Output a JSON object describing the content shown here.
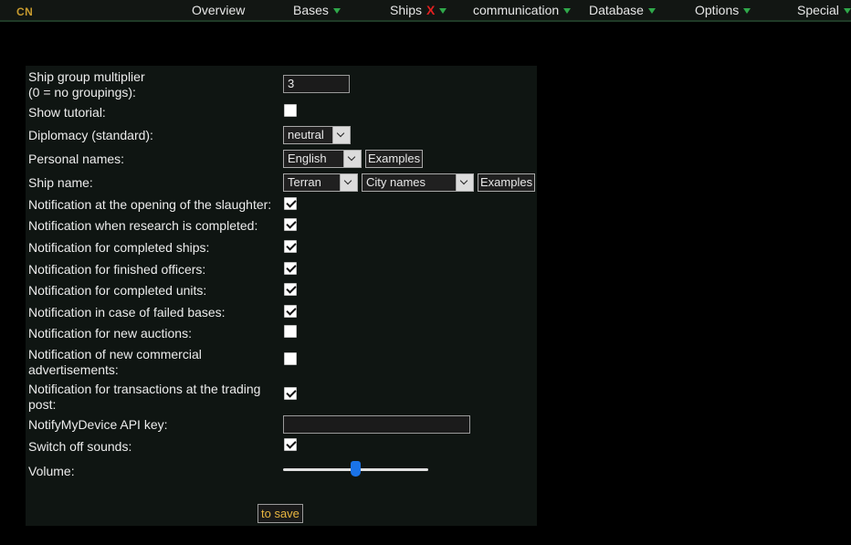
{
  "topbar": {
    "logo": "CN",
    "items": [
      {
        "label": "Overview"
      },
      {
        "label": "Bases"
      },
      {
        "label": "Ships"
      },
      {
        "label": "communication"
      },
      {
        "label": "Database"
      },
      {
        "label": "Options"
      },
      {
        "label": "Special"
      }
    ]
  },
  "settings": {
    "group_multiplier": {
      "label_line1": "Ship group multiplier",
      "label_line2": "(0 = no groupings):",
      "value": "3"
    },
    "tutorial": {
      "label": "Show tutorial:",
      "checked": false
    },
    "diplomacy": {
      "label": "Diplomacy (standard):",
      "value": "neutral"
    },
    "personal_names": {
      "label": "Personal names:",
      "value": "English",
      "examples": "Examples"
    },
    "ship_name": {
      "label": "Ship name:",
      "value1": "Terran",
      "value2": "City names",
      "examples": "Examples"
    },
    "notify_slaughter": {
      "label": "Notification at the opening of the slaughter:",
      "checked": true
    },
    "notify_research": {
      "label": "Notification when research is completed:",
      "checked": true
    },
    "notify_ships": {
      "label": "Notification for completed ships:",
      "checked": true
    },
    "notify_officers": {
      "label": "Notification for finished officers:",
      "checked": true
    },
    "notify_units": {
      "label": "Notification for completed units:",
      "checked": true
    },
    "notify_failed_bases": {
      "label": "Notification in case of failed bases:",
      "checked": true
    },
    "notify_auctions": {
      "label": "Notification for new auctions:",
      "checked": false
    },
    "notify_ads": {
      "label_line1": "Notification of new commercial",
      "label_line2": "advertisements:",
      "checked": false
    },
    "notify_trading": {
      "label_line1": "Notification for transactions at the trading",
      "label_line2": "post:",
      "checked": true
    },
    "api_key": {
      "label": "NotifyMyDevice API key:",
      "value": ""
    },
    "sounds_off": {
      "label": "Switch off sounds:",
      "checked": true
    },
    "volume": {
      "label": "Volume:",
      "level_percent": 50
    }
  },
  "save_label": "to save",
  "colors": {
    "accent": "#1a73e8",
    "save_text": "#e8b640",
    "nav_arrow": "#2fa84a",
    "ships_x": "#e32020"
  }
}
